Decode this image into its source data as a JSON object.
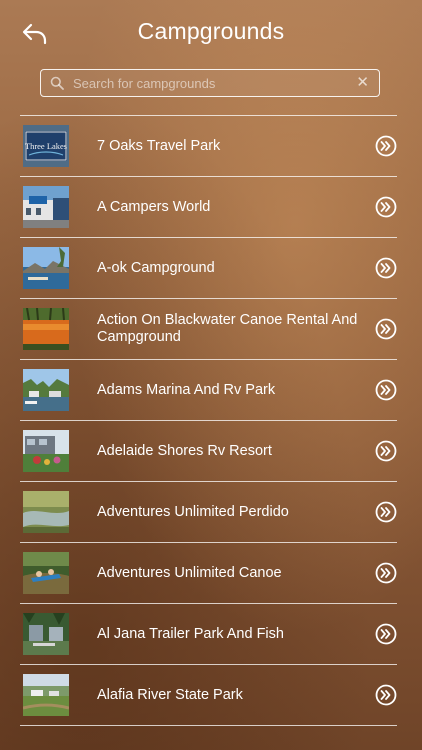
{
  "header": {
    "title": "Campgrounds",
    "back_icon": "back-arrow-icon"
  },
  "search": {
    "placeholder": "Search for campgrounds",
    "value": "",
    "icon": "search-icon",
    "clear_icon": "clear-icon"
  },
  "colors": {
    "background_top": "#ab7a54",
    "background_bottom": "#6f4428",
    "text": "#ffffff",
    "divider": "#ffffff"
  },
  "campgrounds": [
    {
      "name": "7 Oaks Travel Park",
      "thumb_text": "Three Lakes"
    },
    {
      "name": "A Campers World"
    },
    {
      "name": "A-ok Campground"
    },
    {
      "name": "Action On Blackwater Canoe Rental And Campground"
    },
    {
      "name": "Adams Marina And Rv Park"
    },
    {
      "name": "Adelaide Shores Rv Resort"
    },
    {
      "name": "Adventures Unlimited Perdido"
    },
    {
      "name": "Adventures Unlimited Canoe"
    },
    {
      "name": "Al Jana Trailer Park And Fish"
    },
    {
      "name": "Alafia River State Park"
    }
  ]
}
